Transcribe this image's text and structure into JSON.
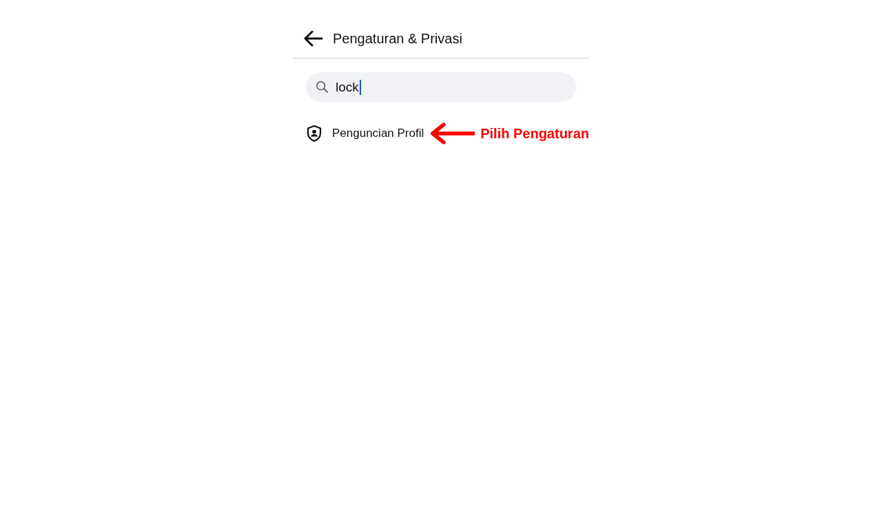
{
  "header": {
    "title": "Pengaturan & Privasi"
  },
  "search": {
    "value": "lock",
    "focused": true
  },
  "results": [
    {
      "label": "Penguncian Profil"
    }
  ],
  "annotation": {
    "text": "Pilih Pengaturan"
  }
}
